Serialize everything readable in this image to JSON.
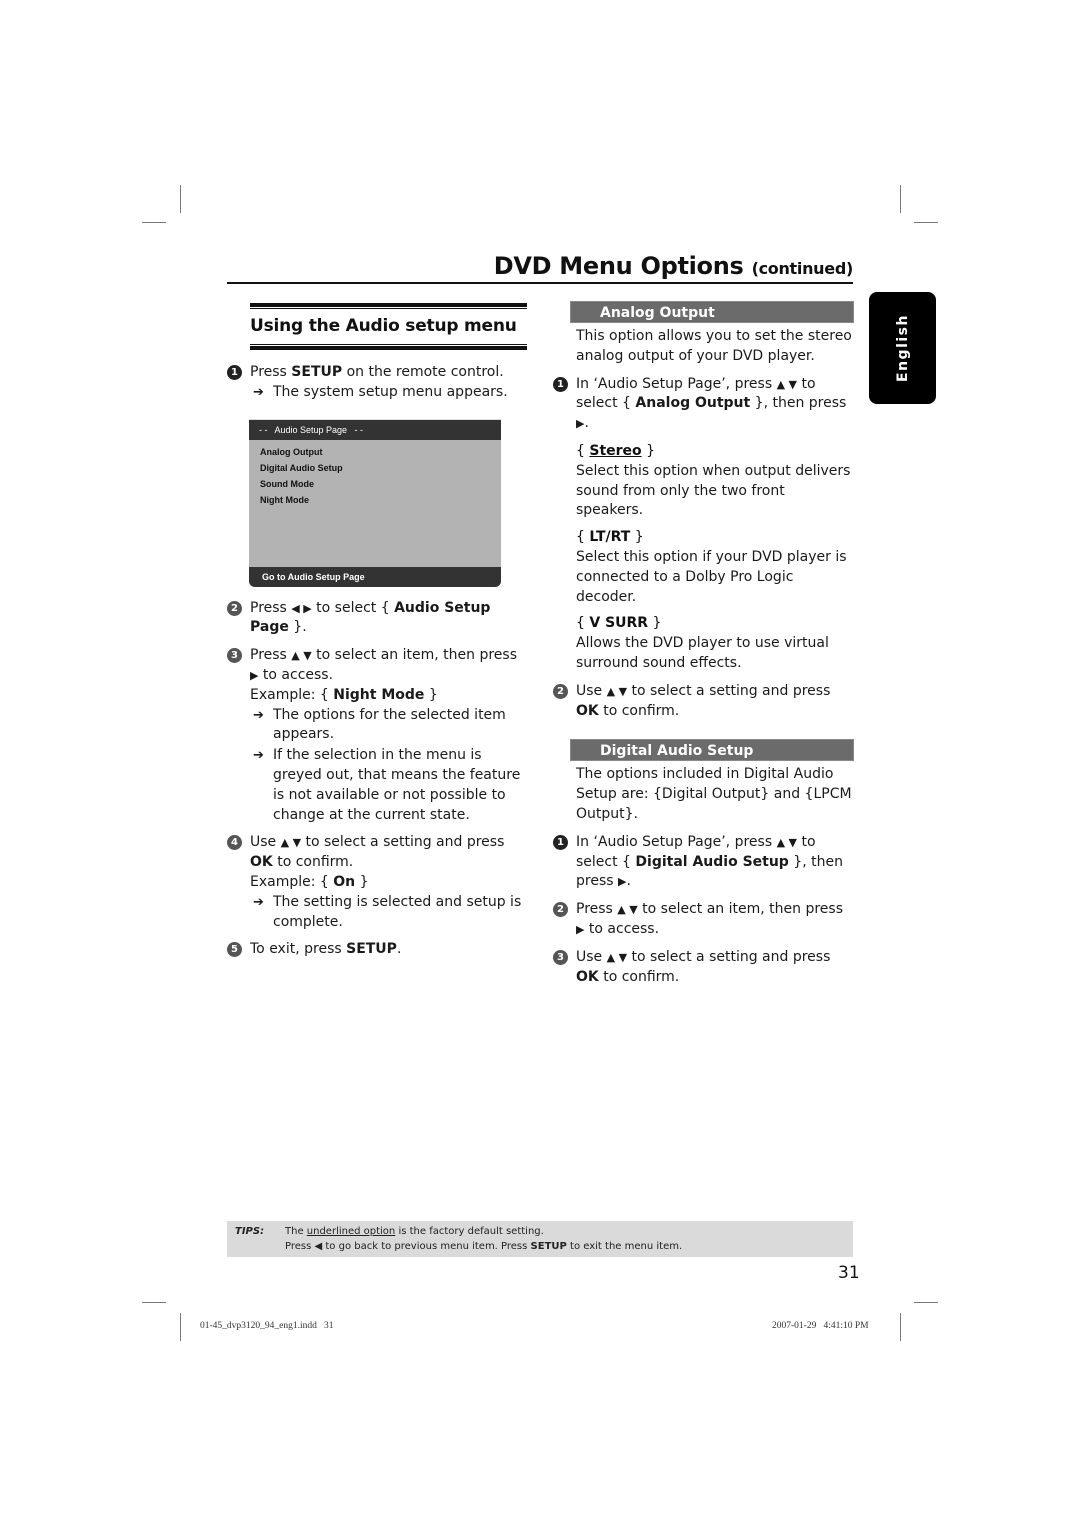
{
  "header": {
    "title": "DVD Menu Options",
    "title_suffix": "(continued)"
  },
  "language_tab": "English",
  "left": {
    "section_title": "Using the Audio setup menu",
    "step1": {
      "num": "1",
      "pre": "Press ",
      "bold": "SETUP",
      "post": " on the remote control.",
      "result": "The system setup menu appears."
    },
    "osd": {
      "header": "- -   Audio Setup Page   - -",
      "items": [
        "Analog Output",
        "Digital Audio Setup",
        "Sound Mode",
        "Night Mode"
      ],
      "footer": "Go to Audio Setup Page"
    },
    "step2": {
      "num": "2",
      "pre": "Press ",
      "keys": "◀ ▶",
      "mid": " to select { ",
      "bold": "Audio Setup Page",
      "post": " }."
    },
    "step3": {
      "num": "3",
      "pre": "Press ",
      "keys": "▲ ▼",
      "mid": " to select an item, then press ",
      "key2": "▶",
      "post": " to access.",
      "example_pre": "Example: { ",
      "example_bold": "Night Mode",
      "example_post": " }",
      "result1": "The options for the selected item appears.",
      "result2": "If the selection in the menu is greyed out, that means the feature is not available or not possible to change at the current state."
    },
    "step4": {
      "num": "4",
      "pre": "Use ",
      "keys": "▲ ▼",
      "mid": " to select a setting and press ",
      "bold": "OK",
      "post": " to confirm.",
      "example_pre": "Example: { ",
      "example_bold": "On",
      "example_post": " }",
      "result": "The setting is selected and setup is complete."
    },
    "step5": {
      "num": "5",
      "pre": "To exit, press ",
      "bold": "SETUP",
      "post": "."
    }
  },
  "right": {
    "analog": {
      "header": "Analog Output",
      "intro": "This option allows you to set the stereo analog output of your DVD player.",
      "step1": {
        "num": "1",
        "pre": "In ‘Audio Setup Page’, press ",
        "keys": "▲ ▼",
        "mid": " to select { ",
        "bold": "Analog Output",
        "post": " }, then press ",
        "key2": "▶",
        "end": "."
      },
      "options": [
        {
          "name": "Stereo",
          "default": true,
          "desc": "Select this option when output delivers sound from only the two front speakers."
        },
        {
          "name": "LT/RT",
          "default": false,
          "desc": "Select this option if your DVD player is connected to a Dolby Pro Logic decoder."
        },
        {
          "name": "V SURR",
          "default": false,
          "desc": "Allows the DVD player to use virtual surround sound effects."
        }
      ],
      "step2": {
        "num": "2",
        "pre": "Use ",
        "keys": "▲ ▼",
        "mid": " to select a setting and press ",
        "bold": "OK",
        "post": " to confirm."
      }
    },
    "digital": {
      "header": "Digital Audio Setup",
      "intro": "The options included in Digital Audio Setup are: {Digital Output} and {LPCM Output}.",
      "step1": {
        "num": "1",
        "pre": "In ‘Audio Setup Page’, press ",
        "keys": "▲ ▼",
        "mid": " to select { ",
        "bold": "Digital Audio Setup",
        "post": " }, then press ",
        "key2": "▶",
        "end": "."
      },
      "step2": {
        "num": "2",
        "pre": "Press ",
        "keys": "▲ ▼",
        "mid": " to select an item, then press ",
        "key2": "▶",
        "post": " to access."
      },
      "step3": {
        "num": "3",
        "pre": "Use ",
        "keys": "▲ ▼",
        "mid": " to select a setting and press ",
        "bold": "OK",
        "post": " to confirm."
      }
    }
  },
  "tips": {
    "label": "TIPS:",
    "line1_pre": "The ",
    "line1_underlined": "underlined option",
    "line1_post": " is the factory default setting.",
    "line2_pre": "Press ",
    "line2_key": "◀",
    "line2_mid": " to go back to previous menu item. Press ",
    "line2_bold": "SETUP",
    "line2_post": " to exit the menu item."
  },
  "page_number": "31",
  "slug": {
    "file": "01-45_dvp3120_94_eng1.indd   31",
    "timestamp": "2007-01-29   4:41:10 PM"
  },
  "colors": {
    "section_bar": "#6b6b6b",
    "osd_bg": "#b3b3b3",
    "osd_bar": "#333333",
    "tips_bg": "#dadada"
  }
}
